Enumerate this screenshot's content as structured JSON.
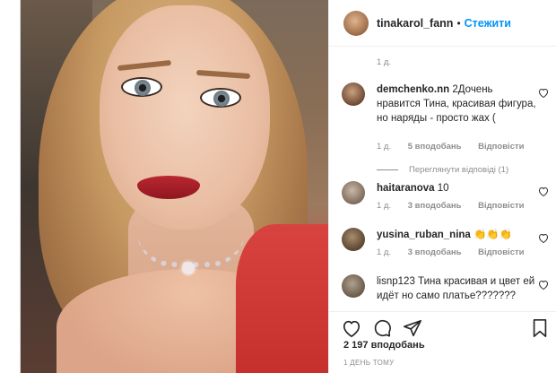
{
  "header": {
    "username": "tinakarol_fann",
    "separator": "•",
    "follow_label": "Стежити"
  },
  "comments": {
    "top_time": "1 д.",
    "items": [
      {
        "username": "demchenko.nn",
        "text": "2Дочень нравится Тина, красивая фигура, но наряды - просто жах (",
        "time": "1 д.",
        "likes": "5 вподобань",
        "reply": "Відповісти",
        "view_replies": "Переглянути відповіді (1)"
      },
      {
        "username": "haitaranova",
        "text": "10",
        "time": "1 д.",
        "likes": "3 вподобань",
        "reply": "Відповісти"
      },
      {
        "username": "yusina_ruban_nina",
        "text": "👏👏👏",
        "time": "1 д.",
        "likes": "3 вподобань",
        "reply": "Відповісти"
      },
      {
        "username": "lisnp123",
        "text": "Тина красивая и цвет ей идёт но само платье???????",
        "time": "",
        "likes": "",
        "reply": ""
      }
    ]
  },
  "footer": {
    "likes_count": "2 197 вподобань",
    "time_ago": "1 ДЕНЬ ТОМУ"
  },
  "icons": {
    "like": "heart-icon",
    "comment": "comment-icon",
    "share": "share-icon",
    "save": "bookmark-icon"
  }
}
